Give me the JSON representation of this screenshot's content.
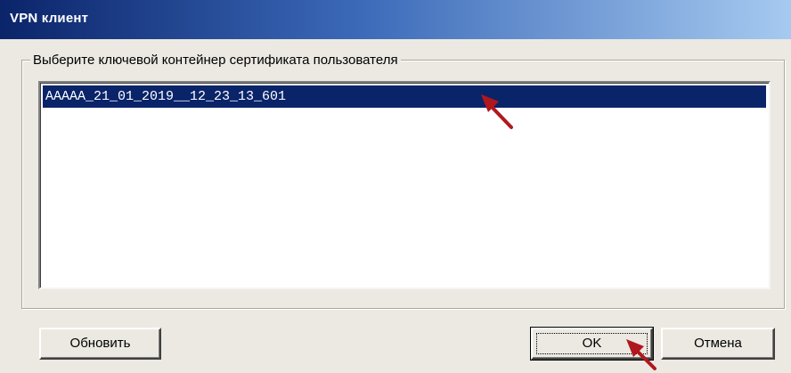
{
  "window": {
    "title": "VPN клиент"
  },
  "group": {
    "label": "Выберите ключевой контейнер сертификата пользователя"
  },
  "list": {
    "items": [
      "AAAAA_21_01_2019__12_23_13_601"
    ],
    "selected_index": 0
  },
  "buttons": {
    "refresh_label": "Обновить",
    "ok_label": "OK",
    "cancel_label": "Отмена"
  },
  "annotation": {
    "arrow_color": "#b0181e"
  }
}
